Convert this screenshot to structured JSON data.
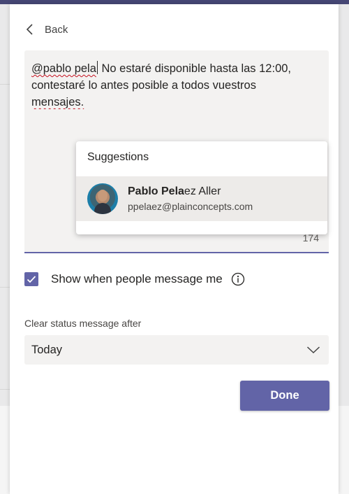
{
  "nav": {
    "back_label": "Back"
  },
  "editor": {
    "segments": {
      "s1": "@pablo pela",
      "s2": "No estaré disponible hasta las 12:00,",
      "s3": "contestaré lo antes posible a todos vuestros",
      "s4": "mensajes."
    },
    "remaining_chars": "174"
  },
  "suggestions": {
    "title": "Suggestions",
    "items": [
      {
        "name_bold": "Pablo Pela",
        "name_rest": "ez Aller",
        "email": "ppelaez@plainconcepts.com",
        "avatar": "user-photo"
      }
    ]
  },
  "options": {
    "show_when_message": {
      "label": "Show when people message me",
      "checked": true
    }
  },
  "clear_after": {
    "label": "Clear status message after",
    "selected": "Today"
  },
  "actions": {
    "done_label": "Done"
  },
  "colors": {
    "accent": "#6264a7",
    "topbar": "#464775",
    "field_bg": "#f3f2f1",
    "spellcheck": "#c50f1f"
  },
  "icons": [
    "chevron-left-icon",
    "checkmark-icon",
    "info-icon",
    "chevron-down-icon"
  ]
}
